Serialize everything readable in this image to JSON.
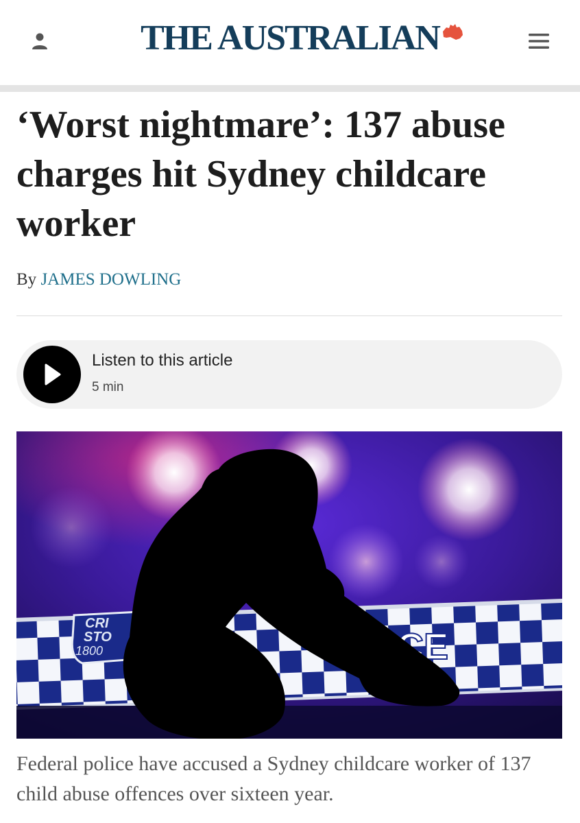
{
  "header": {
    "masthead": "THE AUSTRALIAN",
    "user_icon": "user-icon",
    "menu_icon": "hamburger-menu-icon",
    "brand_color": "#143d5a",
    "accent_color": "#e5533d"
  },
  "article": {
    "headline": "‘Worst nightmare’: 137 abuse charges hit Sydney childcare worker",
    "byline_prefix": "By",
    "author": "JAMES DOWLING",
    "author_color": "#1f6f8b"
  },
  "audio": {
    "title": "Listen to this article",
    "duration": "5 min",
    "play_icon": "play-icon"
  },
  "hero_image": {
    "tape_text_left_1": "CRI",
    "tape_text_left_2": "STO",
    "tape_phone": "1800",
    "tape_police": "ICE"
  },
  "caption": "Federal police have accused a Sydney childcare worker of 137 child abuse offences over sixteen year."
}
